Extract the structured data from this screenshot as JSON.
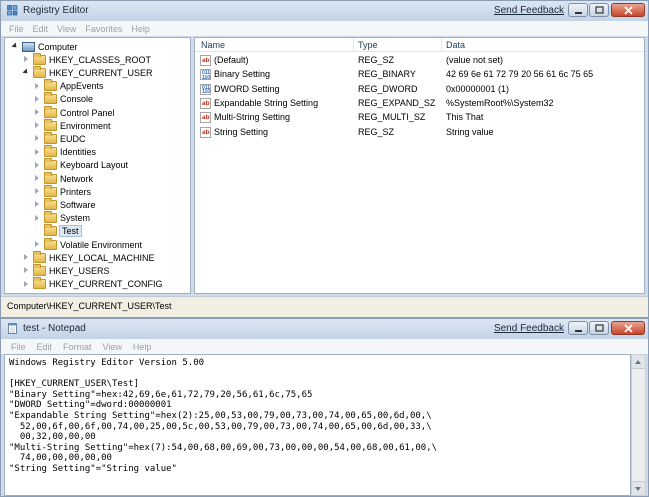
{
  "regedit": {
    "title": "Registry Editor",
    "send_feedback": "Send Feedback",
    "menu": [
      "File",
      "Edit",
      "View",
      "Favorites",
      "Help"
    ],
    "tree": [
      {
        "label": "Computer",
        "arrow": "expanded",
        "icon": "computer",
        "indent": 0
      },
      {
        "label": "HKEY_CLASSES_ROOT",
        "arrow": "collapsed",
        "icon": "folder",
        "indent": 1
      },
      {
        "label": "HKEY_CURRENT_USER",
        "arrow": "expanded",
        "icon": "folder",
        "indent": 1
      },
      {
        "label": "AppEvents",
        "arrow": "collapsed",
        "icon": "folder",
        "indent": 2
      },
      {
        "label": "Console",
        "arrow": "collapsed",
        "icon": "folder",
        "indent": 2
      },
      {
        "label": "Control Panel",
        "arrow": "collapsed",
        "icon": "folder",
        "indent": 2
      },
      {
        "label": "Environment",
        "arrow": "collapsed",
        "icon": "folder",
        "indent": 2
      },
      {
        "label": "EUDC",
        "arrow": "collapsed",
        "icon": "folder",
        "indent": 2
      },
      {
        "label": "Identities",
        "arrow": "collapsed",
        "icon": "folder",
        "indent": 2
      },
      {
        "label": "Keyboard Layout",
        "arrow": "collapsed",
        "icon": "folder",
        "indent": 2
      },
      {
        "label": "Network",
        "arrow": "collapsed",
        "icon": "folder",
        "indent": 2
      },
      {
        "label": "Printers",
        "arrow": "collapsed",
        "icon": "folder",
        "indent": 2
      },
      {
        "label": "Software",
        "arrow": "collapsed",
        "icon": "folder",
        "indent": 2
      },
      {
        "label": "System",
        "arrow": "collapsed",
        "icon": "folder",
        "indent": 2
      },
      {
        "label": "Test",
        "arrow": "none",
        "icon": "folder",
        "indent": 2,
        "selected": true
      },
      {
        "label": "Volatile Environment",
        "arrow": "collapsed",
        "icon": "folder",
        "indent": 2
      },
      {
        "label": "HKEY_LOCAL_MACHINE",
        "arrow": "collapsed",
        "icon": "folder",
        "indent": 1
      },
      {
        "label": "HKEY_USERS",
        "arrow": "collapsed",
        "icon": "folder",
        "indent": 1
      },
      {
        "label": "HKEY_CURRENT_CONFIG",
        "arrow": "collapsed",
        "icon": "folder",
        "indent": 1
      }
    ],
    "columns": {
      "name": "Name",
      "type": "Type",
      "data": "Data"
    },
    "values": [
      {
        "name": "(Default)",
        "type": "REG_SZ",
        "data": "(value not set)",
        "icon": "string"
      },
      {
        "name": "Binary Setting",
        "type": "REG_BINARY",
        "data": "42 69 6e 61 72 79 20 56 61 6c 75 65",
        "icon": "binary"
      },
      {
        "name": "DWORD Setting",
        "type": "REG_DWORD",
        "data": "0x00000001 (1)",
        "icon": "binary"
      },
      {
        "name": "Expandable String Setting",
        "type": "REG_EXPAND_SZ",
        "data": "%SystemRoot%\\System32",
        "icon": "string"
      },
      {
        "name": "Multi-String Setting",
        "type": "REG_MULTI_SZ",
        "data": "This That",
        "icon": "string"
      },
      {
        "name": "String Setting",
        "type": "REG_SZ",
        "data": "String value",
        "icon": "string"
      }
    ],
    "status_path": "Computer\\HKEY_CURRENT_USER\\Test"
  },
  "notepad": {
    "title": "test - Notepad",
    "send_feedback": "Send Feedback",
    "menu": [
      "File",
      "Edit",
      "Format",
      "View",
      "Help"
    ],
    "lines": [
      "Windows Registry Editor Version 5.00",
      "",
      "[HKEY_CURRENT_USER\\Test]",
      "\"Binary Setting\"=hex:42,69,6e,61,72,79,20,56,61,6c,75,65",
      "\"DWORD Setting\"=dword:00000001",
      "\"Expandable String Setting\"=hex(2):25,00,53,00,79,00,73,00,74,00,65,00,6d,00,\\",
      "  52,00,6f,00,6f,00,74,00,25,00,5c,00,53,00,79,00,73,00,74,00,65,00,6d,00,33,\\",
      "  00,32,00,00,00",
      "\"Multi-String Setting\"=hex(7):54,00,68,00,69,00,73,00,00,00,54,00,68,00,61,00,\\",
      "  74,00,00,00,00,00",
      "\"String Setting\"=\"String value\""
    ]
  },
  "colors": {
    "selection": "#dfe9f5",
    "window_frame": "#cfdbe9",
    "status_bar": "#f1efe2"
  }
}
